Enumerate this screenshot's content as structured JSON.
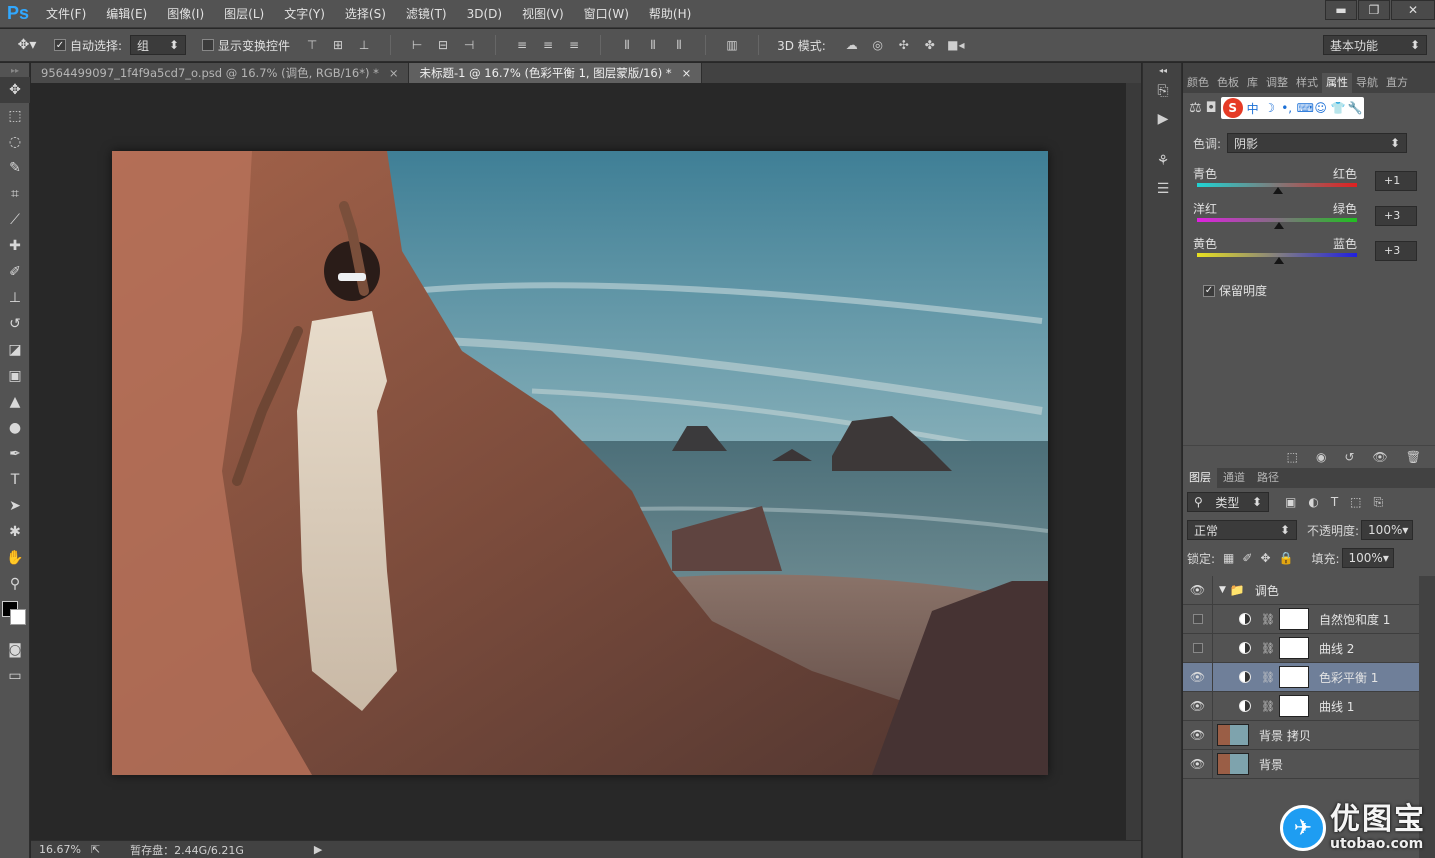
{
  "app": {
    "logo": "Ps"
  },
  "menu": [
    "文件(F)",
    "编辑(E)",
    "图像(I)",
    "图层(L)",
    "文字(Y)",
    "选择(S)",
    "滤镜(T)",
    "3D(D)",
    "视图(V)",
    "窗口(W)",
    "帮助(H)"
  ],
  "window_controls": {
    "minimize": "▬",
    "restore": "❐",
    "close": "✕"
  },
  "options": {
    "auto_select_label": "自动选择:",
    "auto_select_value": "组",
    "show_transform_label": "显示变换控件",
    "mode_3d_label": "3D 模式:",
    "workspace": "基本功能"
  },
  "tabs": [
    {
      "label": "9564499097_1f4f9a5cd7_o.psd @ 16.7% (调色, RGB/16*) *",
      "close": "×"
    },
    {
      "label": "未标题-1 @ 16.7% (色彩平衡 1, 图层蒙版/16) *",
      "close": "×"
    }
  ],
  "status": {
    "zoom": "16.67%",
    "scratch": "暂存盘：2.44G/6.21G"
  },
  "panel_tabs": [
    "颜色",
    "色板",
    "库",
    "调整",
    "样式",
    "属性",
    "导航",
    "直方"
  ],
  "ime": {
    "s": "S",
    "chinese": "中"
  },
  "properties": {
    "tone_label": "色调:",
    "tone_value": "阴影",
    "sliders": [
      {
        "left": "青色",
        "right": "红色",
        "value": "+1",
        "position": 1,
        "colors": [
          "#1fd3d3",
          "#e02020"
        ]
      },
      {
        "left": "洋红",
        "right": "绿色",
        "value": "+3",
        "position": 3,
        "colors": [
          "#e020e0",
          "#20c020"
        ]
      },
      {
        "left": "黄色",
        "right": "蓝色",
        "value": "+3",
        "position": 3,
        "colors": [
          "#e8e020",
          "#2020e0"
        ]
      }
    ],
    "preserve_label": "保留明度"
  },
  "layers_tabs": [
    "图层",
    "通道",
    "路径"
  ],
  "layers": {
    "filter_label": "类型",
    "blend_mode": "正常",
    "opacity_label": "不透明度:",
    "opacity_value": "100%",
    "lock_label": "锁定:",
    "fill_label": "填充:",
    "fill_value": "100%",
    "items": [
      {
        "name": "调色",
        "type": "group",
        "visible": true
      },
      {
        "name": "自然饱和度 1",
        "type": "adjustment",
        "visible": false
      },
      {
        "name": "曲线 2",
        "type": "adjustment",
        "visible": false
      },
      {
        "name": "色彩平衡 1",
        "type": "adjustment",
        "visible": true,
        "selected": true
      },
      {
        "name": "曲线 1",
        "type": "adjustment",
        "visible": true
      },
      {
        "name": "背景 拷贝",
        "type": "image",
        "visible": true
      },
      {
        "name": "背景",
        "type": "image",
        "visible": true
      }
    ]
  },
  "watermark": {
    "title": "优图宝",
    "url": "utobao.com"
  }
}
